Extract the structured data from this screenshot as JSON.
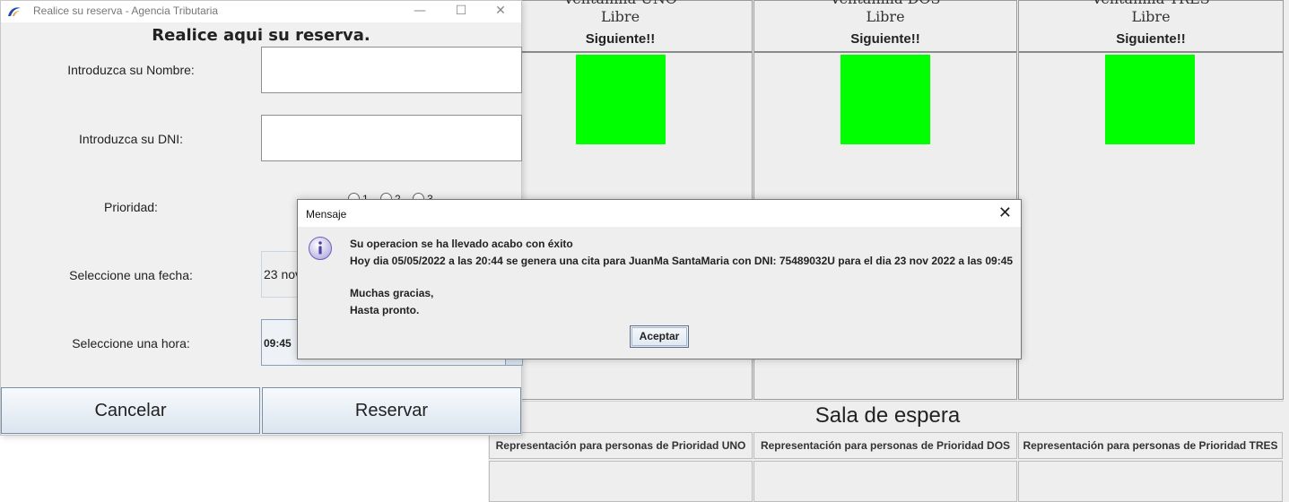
{
  "background_window": {
    "windows": [
      {
        "title": "Ventanilla UNO",
        "state": "Libre",
        "next_label": "Siguiente!!"
      },
      {
        "title": "Ventanilla DOS",
        "state": "Libre",
        "next_label": "Siguiente!!"
      },
      {
        "title": "Ventanilla TRES",
        "state": "Libre",
        "next_label": "Siguiente!!"
      }
    ],
    "status_color": "#00ff00",
    "waiting_room_title": "Sala de espera",
    "priority_columns": [
      "Representación para personas de Prioridad UNO",
      "Representación para personas de Prioridad DOS",
      "Representación para personas de Prioridad TRES"
    ]
  },
  "reservation_window": {
    "title": "Realice su reserva - Agencia Tributaria",
    "heading": "Realice aqui su reserva.",
    "name_label": "Introduzca su Nombre:",
    "dni_label": "Introduzca su DNI:",
    "priority_label": "Prioridad:",
    "priority_options": [
      "1",
      "2",
      "3"
    ],
    "date_label": "Seleccione una fecha:",
    "date_value": "23 nov",
    "time_label": "Seleccione una hora:",
    "time_value": "09:45",
    "cancel_label": "Cancelar",
    "reserve_label": "Reservar",
    "controls": {
      "minimize": "—",
      "maximize": "☐",
      "close": "✕"
    }
  },
  "dialog": {
    "title": "Mensaje",
    "close_glyph": "✕",
    "lines": [
      "Su operacion se ha llevado acabo con éxito",
      "Hoy dia 05/05/2022 a las 20:44 se genera una cita para JuanMa SantaMaria con DNI: 75489032U  para el dia 23 nov 2022 a las 09:45",
      "Muchas gracias,",
      "Hasta pronto."
    ],
    "ok_label": "Aceptar",
    "icon": "info-icon"
  }
}
